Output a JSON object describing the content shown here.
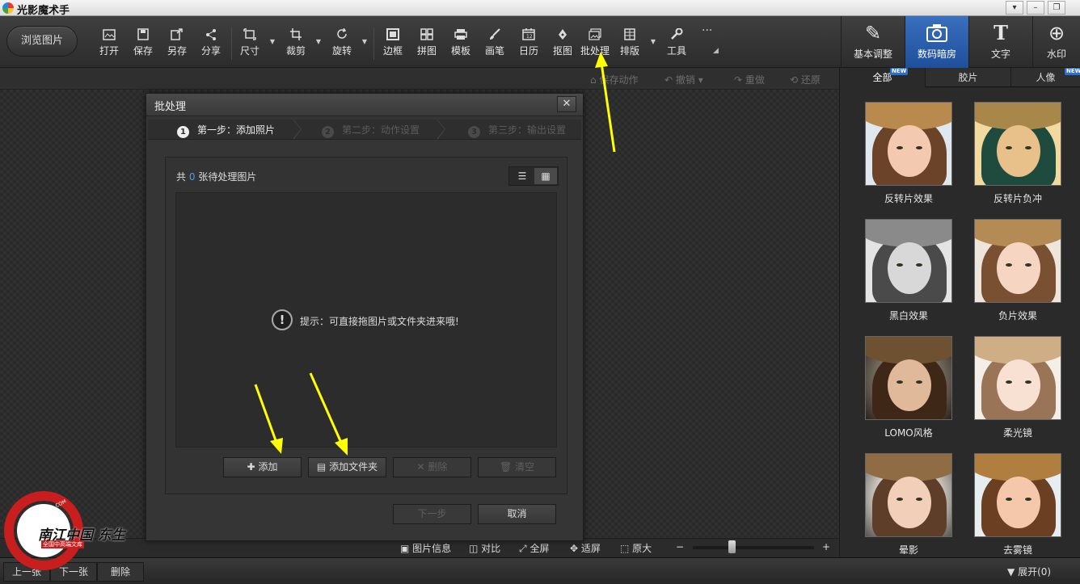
{
  "app": {
    "title": "光影魔术手"
  },
  "window_controls": [
    "▾",
    "–",
    "❐"
  ],
  "toolbar": {
    "browse_label": "浏览图片",
    "tools": [
      {
        "id": "open",
        "label": "打开"
      },
      {
        "id": "save",
        "label": "保存"
      },
      {
        "id": "save-as",
        "label": "另存"
      },
      {
        "id": "share",
        "label": "分享"
      },
      {
        "id": "size",
        "label": "尺寸"
      },
      {
        "id": "crop",
        "label": "裁剪"
      },
      {
        "id": "rotate",
        "label": "旋转"
      },
      {
        "id": "border",
        "label": "边框"
      },
      {
        "id": "collage",
        "label": "拼图"
      },
      {
        "id": "template",
        "label": "模板"
      },
      {
        "id": "brush",
        "label": "画笔"
      },
      {
        "id": "calendar",
        "label": "日历"
      },
      {
        "id": "cutout",
        "label": "抠图"
      },
      {
        "id": "batch",
        "label": "批处理"
      },
      {
        "id": "layout",
        "label": "排版"
      },
      {
        "id": "tools",
        "label": "工具"
      }
    ],
    "more": "···"
  },
  "right_tabs": [
    {
      "label": "基本调整",
      "icon": "✎"
    },
    {
      "label": "数码暗房",
      "icon": "📷"
    },
    {
      "label": "文字",
      "icon": "T"
    },
    {
      "label": "水印",
      "icon": "⊕"
    }
  ],
  "subbar": {
    "save_action": "保存动作",
    "undo": "撤销",
    "redo": "重做",
    "restore": "还原"
  },
  "panel": {
    "tabs": [
      "全部",
      "胶片",
      "人像"
    ],
    "new_badge": "NEW",
    "effects": [
      {
        "label": "反转片效果"
      },
      {
        "label": "反转片负冲"
      },
      {
        "label": "黑白效果"
      },
      {
        "label": "负片效果"
      },
      {
        "label": "LOMO风格"
      },
      {
        "label": "柔光镜"
      },
      {
        "label": "晕影"
      },
      {
        "label": "去雾镜"
      }
    ]
  },
  "bottom": {
    "image_info": "图片信息",
    "compare": "对比",
    "fullscreen": "全屏",
    "fit": "适屏",
    "original": "原大",
    "zoom_minus": "−",
    "zoom_plus": "+",
    "zoom_level": 0.32
  },
  "statusbar": {
    "prev": "上一张",
    "next": "下一张",
    "delete": "删除",
    "expand": "展开",
    "expand_count": "(0)"
  },
  "dialog": {
    "title": "批处理",
    "close": "✕",
    "steps": [
      {
        "num": "1",
        "label": "第一步：添加照片"
      },
      {
        "num": "2",
        "label": "第二步：动作设置"
      },
      {
        "num": "3",
        "label": "第三步：输出设置"
      }
    ],
    "count_prefix": "共",
    "count_value": "0",
    "count_suffix": "张待处理图片",
    "hint": "提示：可直接拖图片或文件夹进来哦!",
    "buttons": {
      "add": "添加",
      "add_folder": "添加文件夹",
      "delete": "删除",
      "clear": "清空",
      "next": "下一步",
      "cancel": "取消"
    }
  },
  "watermark": {
    "text": "南江中国 东生",
    "url": "WWW.CGH20.COM",
    "sub": "全国中高端文库"
  }
}
